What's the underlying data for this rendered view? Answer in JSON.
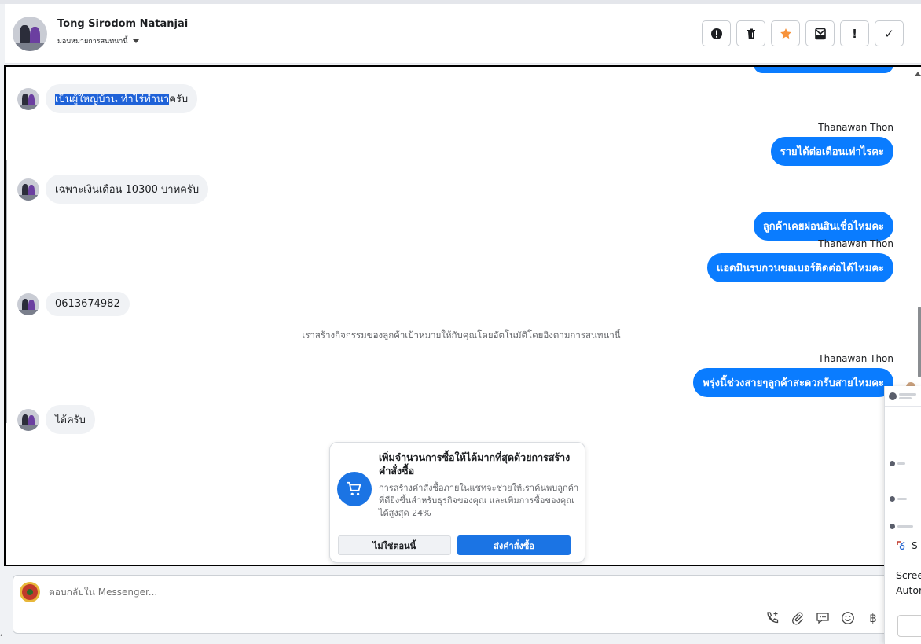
{
  "header": {
    "name": "Tong Sirodom Natanjai",
    "assign_label": "มอบหมายการสนทนานี้"
  },
  "actions": [
    {
      "name": "report-button",
      "glyph": "!"
    },
    {
      "name": "delete-button",
      "glyph": ""
    },
    {
      "name": "star-button",
      "glyph": ""
    },
    {
      "name": "archive-button",
      "glyph": ""
    },
    {
      "name": "spam-button",
      "glyph": "!"
    },
    {
      "name": "done-button",
      "glyph": "✓"
    }
  ],
  "messages": {
    "m1_highlight": "เป็นผู้ใหญ่บ้าน ทำไร่ทำนา",
    "m1_rest": "ครับ",
    "sender1": "Thanawan Thon",
    "o1": "รายได้ต่อเดือนเท่าไรคะ",
    "m2": "เฉพาะเงินเดือน 10300 บาทครับ",
    "o2": "ลูกค้าเคยผ่อนสินเชื่อไหมคะ",
    "sender2": "Thanawan Thon",
    "o3": "แอดมินรบกวนขอเบอร์ติดต่อได้ไหมคะ",
    "m3": "0613674982",
    "system_note": "เราสร้างกิจกรรมของลูกค้าเป้าหมายให้กับคุณโดยอัตโนมัติโดยอิงตามการสนทนานี้",
    "sender3": "Thanawan Thon",
    "o4": "พรุ่งนี้ช่วงสายๆลูกค้าสะดวกรับสายไหมคะ",
    "m4": "ได้ครับ"
  },
  "promo": {
    "title": "เพิ่มจำนวนการซื้อให้ได้มากที่สุดด้วยการสร้างคำสั่งซื้อ",
    "body": "การสร้างคำสั่งซื้อภายในแชทจะช่วยให้เราค้นพบลูกค้าที่ดียิ่งขึ้นสำหรับธุรกิจของคุณ และเพิ่มการซื้อของคุณได้สูงสุด 24%",
    "not_now": "ไม่ใช่ตอนนี้",
    "send_order": "ส่งคำสั่งซื้อ"
  },
  "composer": {
    "placeholder": "ตอบกลับใน Messenger..."
  },
  "side_panel": {
    "app_initial": "S",
    "line1": "Scree",
    "line2": "Autor"
  },
  "colors": {
    "outgoing_bubble": "#0a7cff",
    "incoming_bubble": "#f0f2f5",
    "primary_button": "#1b74e4",
    "star": "#f7923a"
  }
}
